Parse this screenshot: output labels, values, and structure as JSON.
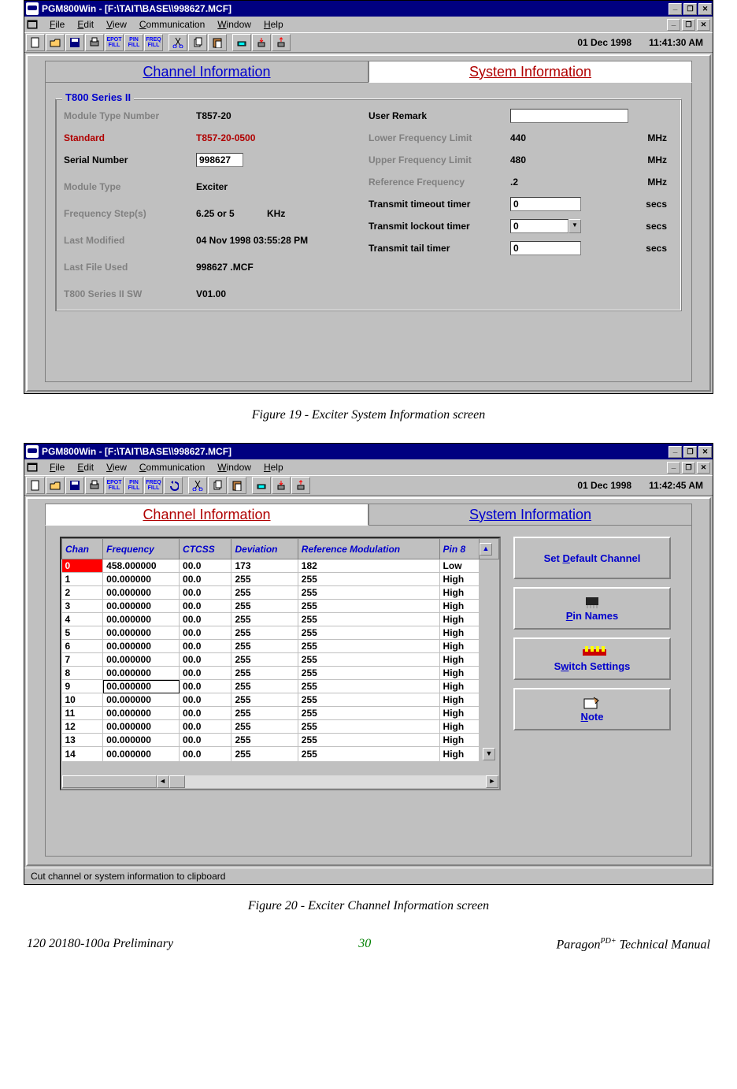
{
  "shot1": {
    "title": "PGM800Win - [F:\\TAIT\\BASE\\\\998627.MCF]",
    "menus": [
      "File",
      "Edit",
      "View",
      "Communication",
      "Window",
      "Help"
    ],
    "date": "01 Dec 1998",
    "time": "11:41:30 AM",
    "tabs": {
      "channel": "Channel Information",
      "system": "System Information"
    },
    "group_title": "T800 Series II",
    "left": {
      "module_type_number_lbl": "Module Type Number",
      "module_type_number_val": "T857-20",
      "standard_lbl": "Standard",
      "standard_val": "T857-20-0500",
      "serial_number_lbl": "Serial Number",
      "serial_number_val": "998627",
      "module_type_lbl": "Module Type",
      "module_type_val": "Exciter",
      "freq_step_lbl": "Frequency Step(s)",
      "freq_step_val": "6.25 or 5",
      "freq_step_unit": "KHz",
      "last_modified_lbl": "Last Modified",
      "last_modified_val": "04 Nov 1998 03:55:28 PM",
      "last_file_lbl": "Last File Used",
      "last_file_val": "998627  .MCF",
      "sw_lbl": "T800 Series II SW",
      "sw_val": "V01.00"
    },
    "right": {
      "user_remark_lbl": "User Remark",
      "user_remark_val": "",
      "lower_freq_lbl": "Lower Frequency Limit",
      "lower_freq_val": "440",
      "upper_freq_lbl": "Upper Frequency Limit",
      "upper_freq_val": "480",
      "ref_freq_lbl": "Reference Frequency",
      "ref_freq_val": ".2",
      "mhz": "MHz",
      "tx_timeout_lbl": "Transmit timeout timer",
      "tx_timeout_val": "0",
      "tx_lockout_lbl": "Transmit lockout timer",
      "tx_lockout_val": "0",
      "tx_tail_lbl": "Transmit tail timer",
      "tx_tail_val": "0",
      "secs": "secs"
    },
    "caption": "Figure 19 - Exciter System Information screen"
  },
  "shot2": {
    "title": "PGM800Win - [F:\\TAIT\\BASE\\\\998627.MCF]",
    "menus": [
      "File",
      "Edit",
      "View",
      "Communication",
      "Window",
      "Help"
    ],
    "date": "01 Dec 1998",
    "time": "11:42:45 AM",
    "tabs": {
      "channel": "Channel Information",
      "system": "System Information"
    },
    "columns": [
      "Chan",
      "Frequency",
      "CTCSS",
      "Deviation",
      "Reference Modulation",
      "Pin  8"
    ],
    "rows": [
      [
        "0",
        "458.000000",
        "00.0",
        "173",
        "182",
        "Low"
      ],
      [
        "1",
        "00.000000",
        "00.0",
        "255",
        "255",
        "High"
      ],
      [
        "2",
        "00.000000",
        "00.0",
        "255",
        "255",
        "High"
      ],
      [
        "3",
        "00.000000",
        "00.0",
        "255",
        "255",
        "High"
      ],
      [
        "4",
        "00.000000",
        "00.0",
        "255",
        "255",
        "High"
      ],
      [
        "5",
        "00.000000",
        "00.0",
        "255",
        "255",
        "High"
      ],
      [
        "6",
        "00.000000",
        "00.0",
        "255",
        "255",
        "High"
      ],
      [
        "7",
        "00.000000",
        "00.0",
        "255",
        "255",
        "High"
      ],
      [
        "8",
        "00.000000",
        "00.0",
        "255",
        "255",
        "High"
      ],
      [
        "9",
        "00.000000",
        "00.0",
        "255",
        "255",
        "High"
      ],
      [
        "10",
        "00.000000",
        "00.0",
        "255",
        "255",
        "High"
      ],
      [
        "11",
        "00.000000",
        "00.0",
        "255",
        "255",
        "High"
      ],
      [
        "12",
        "00.000000",
        "00.0",
        "255",
        "255",
        "High"
      ],
      [
        "13",
        "00.000000",
        "00.0",
        "255",
        "255",
        "High"
      ],
      [
        "14",
        "00.000000",
        "00.0",
        "255",
        "255",
        "High"
      ]
    ],
    "side": {
      "set_default": "Set Default Channel",
      "pin_names": "Pin Names",
      "switch_settings": "Switch Settings",
      "note": "Note"
    },
    "status": "Cut channel or system information to clipboard",
    "caption": "Figure 20 - Exciter Channel Information screen"
  },
  "footer": {
    "left": "120 20180-100a Preliminary",
    "page": "30",
    "right_prefix": "Paragon",
    "right_sup": "PD+",
    "right_suffix": " Technical Manual"
  },
  "toolbtns": {
    "new": "",
    "open": "",
    "save": "",
    "print": "",
    "epot": "EPOT FILL",
    "pin": "PIN FILL",
    "freq": "FREQ FILL",
    "undo": "",
    "cut": "",
    "copy": "",
    "paste": "",
    "prog": "",
    "read": "",
    "upload": ""
  }
}
